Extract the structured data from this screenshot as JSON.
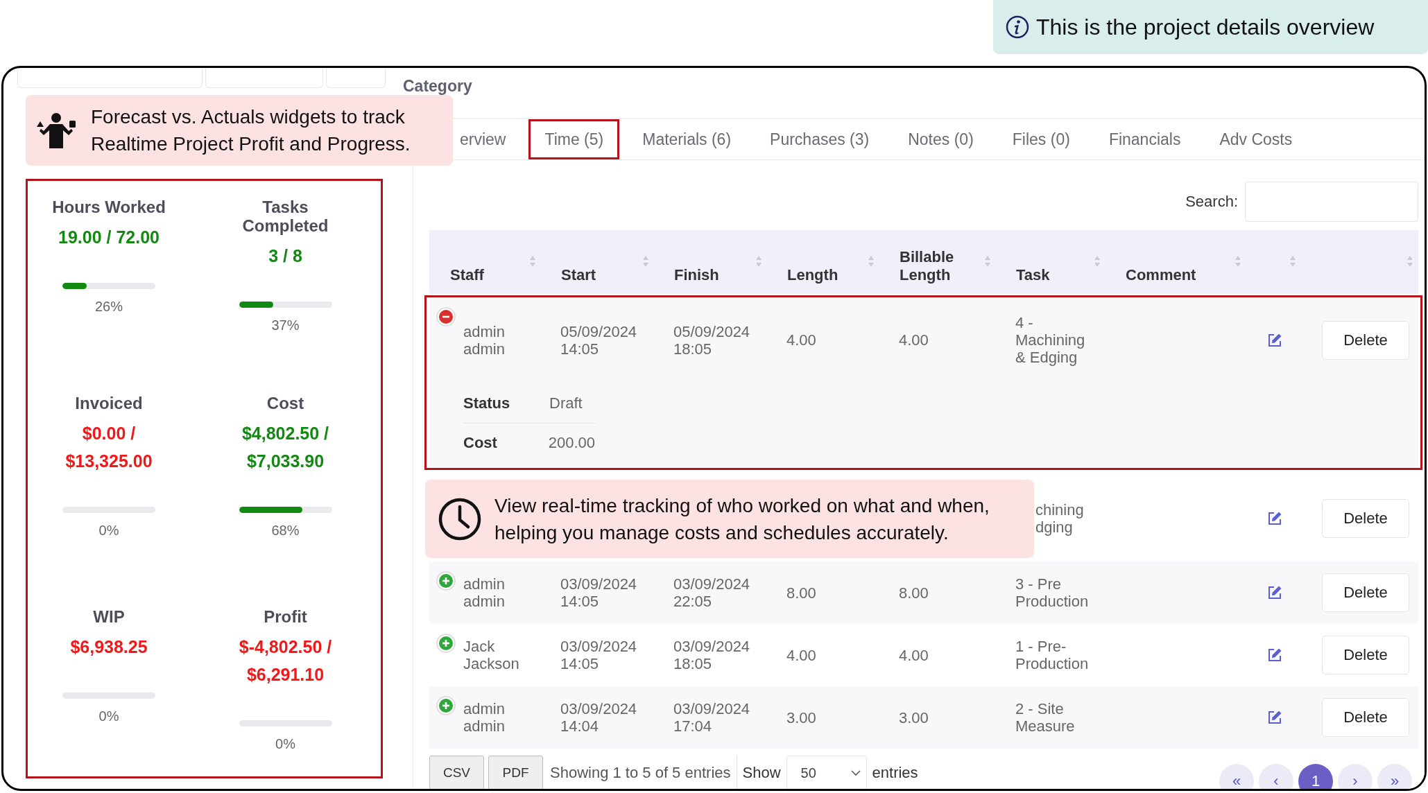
{
  "banner": {
    "text": "This is the project details overview"
  },
  "callouts": [
    {
      "kind": "figure",
      "lines": [
        "Forecast vs. Actuals widgets to track",
        "Realtime Project Profit and Progress."
      ]
    },
    {
      "kind": "clock",
      "lines": [
        "View real-time tracking of who worked on what and when,",
        "helping you manage costs and schedules accurately."
      ]
    }
  ],
  "category_label": "Category",
  "metrics": [
    {
      "title": "Hours Worked",
      "value": "19.00 / 72.00",
      "color": "#128a12",
      "level": 0.26,
      "percent": "26%"
    },
    {
      "title": "Tasks Completed",
      "value": "3 / 8",
      "color": "#128a12",
      "level": 0.37,
      "percent": "37%"
    },
    {
      "title": "Invoiced",
      "value": "$0.00 / $13,325.00",
      "color": "#f01818",
      "level": 0,
      "percent": "0%"
    },
    {
      "title": "Cost",
      "value": "$4,802.50 / $7,033.90",
      "color": "#128a12",
      "level": 0.68,
      "percent": "68%"
    },
    {
      "title": "WIP",
      "value": "$6,938.25",
      "color": "#f01818",
      "level": 0,
      "percent": "0%"
    },
    {
      "title": "Profit",
      "value": "$-4,802.50 / $6,291.10",
      "color": "#f01818",
      "level": 0,
      "percent": "0%"
    }
  ],
  "tabs": [
    {
      "label": "erview",
      "selected": false
    },
    {
      "label": "Time (5)",
      "selected": true
    },
    {
      "label": "Materials (6)",
      "selected": false
    },
    {
      "label": "Purchases (3)",
      "selected": false
    },
    {
      "label": "Notes (0)",
      "selected": false
    },
    {
      "label": "Files (0)",
      "selected": false
    },
    {
      "label": "Financials",
      "selected": false
    },
    {
      "label": "Adv Costs",
      "selected": false
    }
  ],
  "search": {
    "label": "Search:"
  },
  "table": {
    "columns": [
      "Staff",
      "Start",
      "Finish",
      "Length",
      "Billable Length",
      "Task",
      "Comment"
    ],
    "rows": [
      {
        "kind": "full",
        "expanded": true,
        "highlighted": true,
        "staff": "admin admin",
        "start": "05/09/2024 14:05",
        "finish": "05/09/2024 18:05",
        "length": "4.00",
        "billable": "4.00",
        "task": "4 - Machining & Edging",
        "action": "Delete",
        "details": [
          {
            "label": "Status",
            "value": "Draft"
          },
          {
            "label": "Cost",
            "value": "200.00"
          }
        ]
      },
      {
        "kind": "partial",
        "task": "chining dging",
        "action": "Delete"
      },
      {
        "kind": "full",
        "expanded": false,
        "highlighted": false,
        "staff": "admin admin",
        "start": "03/09/2024 14:05",
        "finish": "03/09/2024 22:05",
        "length": "8.00",
        "billable": "8.00",
        "task": "3 - Pre Production",
        "action": "Delete"
      },
      {
        "kind": "full",
        "expanded": false,
        "highlighted": false,
        "staff": "Jack Jackson",
        "start": "03/09/2024 14:05",
        "finish": "03/09/2024 18:05",
        "length": "4.00",
        "billable": "4.00",
        "task": "1 - Pre-Production",
        "action": "Delete"
      },
      {
        "kind": "full",
        "expanded": false,
        "highlighted": false,
        "staff": "admin admin",
        "start": "03/09/2024 14:04",
        "finish": "03/09/2024 17:04",
        "length": "3.00",
        "billable": "3.00",
        "task": "2 - Site Measure",
        "action": "Delete"
      }
    ]
  },
  "footer": {
    "exports": [
      "CSV",
      "PDF"
    ],
    "info": "Showing 1 to 5 of 5 entries",
    "show_label": "Show",
    "page_size": "50",
    "entries_label": "entries",
    "pages": [
      {
        "label": "«",
        "selected": false
      },
      {
        "label": "‹",
        "selected": false
      },
      {
        "label": "1",
        "selected": true
      },
      {
        "label": "›",
        "selected": false
      },
      {
        "label": "»",
        "selected": false
      }
    ]
  }
}
